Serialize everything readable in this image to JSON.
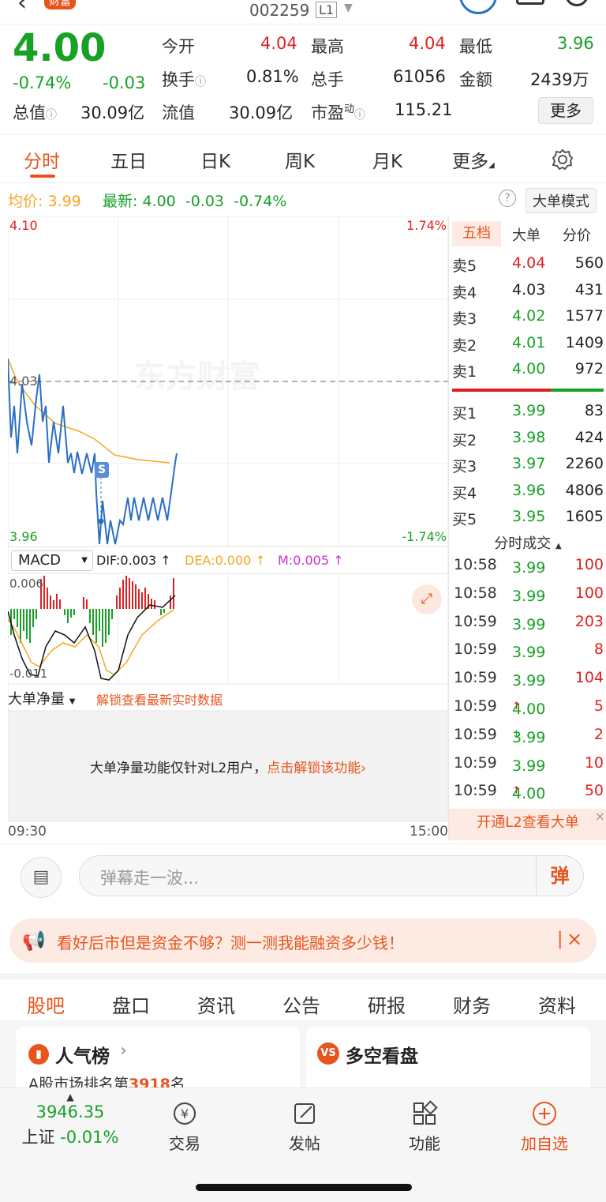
{
  "header": {
    "code": "002259",
    "level": "L1",
    "badge": "财富"
  },
  "quote": {
    "price": "4.00",
    "change_pct": "-0.74%",
    "change": "-0.03",
    "open_label": "今开",
    "open": "4.04",
    "high_label": "最高",
    "high": "4.04",
    "low_label": "最低",
    "low": "3.96",
    "turnover_label": "换手",
    "turnover": "0.81%",
    "volume_label": "总手",
    "volume": "61056",
    "amount_label": "金额",
    "amount": "2439万",
    "mcap_label": "总值",
    "mcap": "30.09亿",
    "float_label": "流值",
    "float": "30.09亿",
    "pe_label": "市盈",
    "pe_sup": "动",
    "pe": "115.21",
    "more": "更多"
  },
  "tabs": [
    "分时",
    "五日",
    "日K",
    "周K",
    "月K",
    "更多"
  ],
  "avg_bar": {
    "avg_label": "均价:",
    "avg": "3.99",
    "latest_label": "最新:",
    "latest": "4.00",
    "change": "-0.03",
    "change_pct": "-0.74%",
    "mode": "大单模式"
  },
  "chart": {
    "y_top": "4.10",
    "y_top_pct": "1.74%",
    "y_mid": "4.03",
    "y_bot": "3.96",
    "y_bot_pct": "-1.74%",
    "watermark": "东方财富",
    "start_time": "09:30",
    "end_time": "15:00",
    "marker": "S"
  },
  "macd": {
    "label": "MACD",
    "dif": "DIF:0.003 ↑",
    "dea": "DEA:0.000 ↑",
    "m": "M:0.005 ↑",
    "top": "0.006",
    "bottom": "-0.011"
  },
  "bignet": {
    "label": "大单净量",
    "unlock": "解锁查看最新实时数据",
    "msg": "大单净量功能仅针对L2用户，",
    "link": "点击解锁该功能"
  },
  "orderbook": {
    "tabs": [
      "五档",
      "大单",
      "分价"
    ],
    "asks": [
      {
        "label": "卖5",
        "price": "4.04",
        "vol": "560"
      },
      {
        "label": "卖4",
        "price": "4.03",
        "vol": "431"
      },
      {
        "label": "卖3",
        "price": "4.02",
        "vol": "1577"
      },
      {
        "label": "卖2",
        "price": "4.01",
        "vol": "1409"
      },
      {
        "label": "卖1",
        "price": "4.00",
        "vol": "972"
      }
    ],
    "bids": [
      {
        "label": "买1",
        "price": "3.99",
        "vol": "83"
      },
      {
        "label": "买2",
        "price": "3.98",
        "vol": "424"
      },
      {
        "label": "买3",
        "price": "3.97",
        "vol": "2260"
      },
      {
        "label": "买4",
        "price": "3.96",
        "vol": "4806"
      },
      {
        "label": "买5",
        "price": "3.95",
        "vol": "1605"
      }
    ],
    "trades_title": "分时成交",
    "trades": [
      {
        "time": "10:58",
        "price": "3.99",
        "arrow": "",
        "vol": "100"
      },
      {
        "time": "10:58",
        "price": "3.99",
        "arrow": "",
        "vol": "100"
      },
      {
        "time": "10:59",
        "price": "3.99",
        "arrow": "",
        "vol": "203"
      },
      {
        "time": "10:59",
        "price": "3.99",
        "arrow": "",
        "vol": "8"
      },
      {
        "time": "10:59",
        "price": "3.99",
        "arrow": "",
        "vol": "104"
      },
      {
        "time": "10:59",
        "price": "4.00",
        "arrow": "↑",
        "vol": "5"
      },
      {
        "time": "10:59",
        "price": "3.99",
        "arrow": "↓",
        "vol": "2"
      },
      {
        "time": "10:59",
        "price": "3.99",
        "arrow": "",
        "vol": "10"
      },
      {
        "time": "10:59",
        "price": "4.00",
        "arrow": "↑",
        "vol": "50"
      }
    ],
    "l2": "开通L2查看大单"
  },
  "danmu": {
    "placeholder": "弹幕走一波...",
    "btn": "弹"
  },
  "banner": {
    "text": "看好后市但是资金不够？测一测我能融资多少钱！"
  },
  "subtabs": [
    "股吧",
    "盘口",
    "资讯",
    "公告",
    "研报",
    "财务",
    "资料"
  ],
  "cards": {
    "popular": "人气榜",
    "rank_prefix": "A股市场排名第",
    "rank": "3918",
    "rank_suffix": "名",
    "vs": "多空看盘"
  },
  "bottom": {
    "index_value": "3946.35",
    "index_name": "上证",
    "index_change": "-0.01%",
    "trade": "交易",
    "post": "发帖",
    "func": "功能",
    "add": "加自选"
  },
  "colors": {
    "up": "#e02020",
    "down": "#17a127",
    "accent": "#e8541e",
    "price_line": "#2a6fc4",
    "avg_line": "#f5a623"
  }
}
